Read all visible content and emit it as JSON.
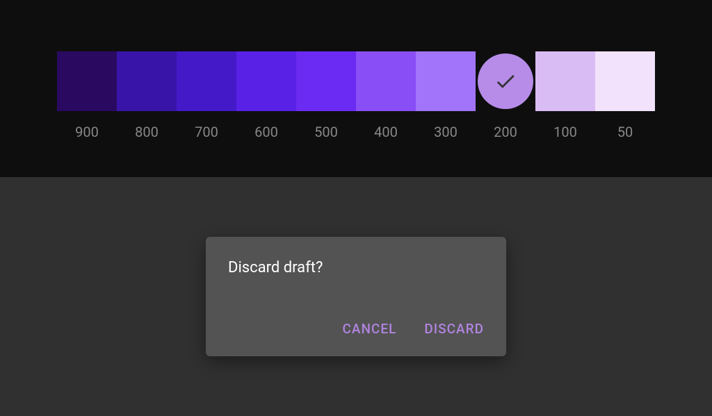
{
  "palette": {
    "swatches": [
      {
        "shade": "900",
        "color": "#2a0a60",
        "selected": false
      },
      {
        "shade": "800",
        "color": "#3815a8",
        "selected": false
      },
      {
        "shade": "700",
        "color": "#4319c8",
        "selected": false
      },
      {
        "shade": "600",
        "color": "#5920e5",
        "selected": false
      },
      {
        "shade": "500",
        "color": "#6c2bf2",
        "selected": false
      },
      {
        "shade": "400",
        "color": "#8a4ef7",
        "selected": false
      },
      {
        "shade": "300",
        "color": "#a274f9",
        "selected": false
      },
      {
        "shade": "200",
        "color": "#b68ce8",
        "selected": true
      },
      {
        "shade": "100",
        "color": "#dabcf5",
        "selected": false
      },
      {
        "shade": "50",
        "color": "#f2e2fb",
        "selected": false
      }
    ],
    "check_color": "#333333"
  },
  "dialog": {
    "title": "Discard draft?",
    "cancel_label": "Cancel",
    "discard_label": "Discard"
  }
}
